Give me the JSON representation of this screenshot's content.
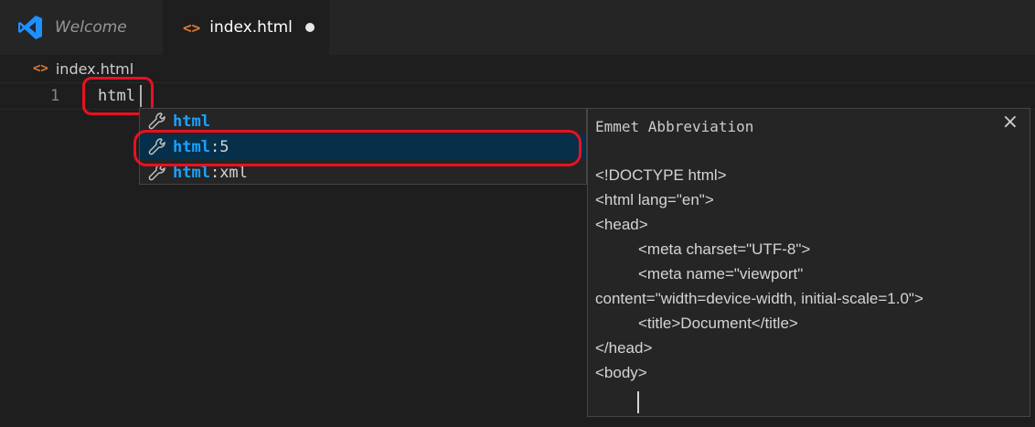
{
  "tabs": [
    {
      "label": "Welcome",
      "icon": "vscode-logo-icon"
    },
    {
      "label": "index.html",
      "icon": "html-file-icon",
      "dirty": true
    }
  ],
  "breadcrumb": {
    "file": "index.html",
    "icon": "html-file-icon"
  },
  "editor": {
    "line_number": "1",
    "text": "html"
  },
  "suggest": {
    "items": [
      {
        "match": "html",
        "rest": "",
        "icon": "wrench-icon"
      },
      {
        "match": "html",
        "rest": ":5",
        "icon": "wrench-icon",
        "selected": true
      },
      {
        "match": "html",
        "rest": ":xml",
        "icon": "wrench-icon"
      }
    ]
  },
  "details": {
    "title": "Emmet Abbreviation",
    "close": "×",
    "lines": [
      "<!DOCTYPE html>",
      "<html lang=\"en\">",
      "<head>",
      "<meta charset=\"UTF-8\">",
      "<meta name=\"viewport\"",
      "content=\"width=device-width, initial-scale=1.0\">",
      "<title>Document</title>",
      "</head>",
      "<body>"
    ]
  },
  "colors": {
    "accent_blue": "#18a3ff",
    "highlight_red": "#e81123",
    "html_icon": "#e37933",
    "selection": "#062f4a"
  }
}
